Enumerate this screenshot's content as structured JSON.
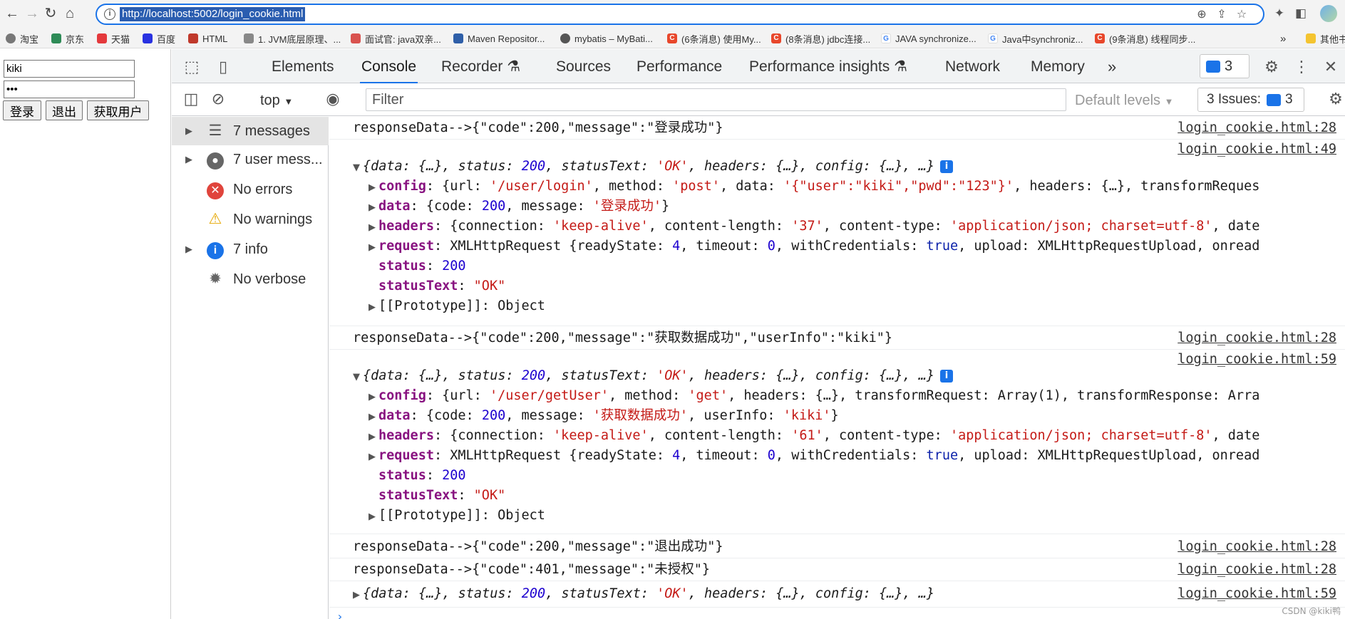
{
  "browser": {
    "url": "http://localhost:5002/login_cookie.html",
    "bookmarks": [
      "淘宝",
      "京东",
      "天猫",
      "百度",
      "HTML",
      "1. JVM底层原理、...",
      "面试官: java双亲...",
      "Maven Repositor...",
      "mybatis – MyBati...",
      "(6条消息) 使用My...",
      "(8条消息) jdbc连接...",
      "JAVA synchronize...",
      "Java中synchroniz...",
      "(9条消息) 线程同步..."
    ],
    "bookmarks_more": "»",
    "other_bookmarks": "其他书"
  },
  "page": {
    "username_value": "kiki",
    "password_value": "•••",
    "login_button": "登录",
    "logout_button": "退出",
    "getuser_button": "获取用户"
  },
  "devtools": {
    "tabs": [
      "Elements",
      "Console",
      "Recorder",
      "Sources",
      "Performance",
      "Performance insights",
      "Network",
      "Memory"
    ],
    "active_tab": "Console",
    "more_tabs": "»",
    "issues_count": "3",
    "context": "top",
    "filter_placeholder": "Filter",
    "levels": "Default levels",
    "issues_label": "3 Issues:",
    "issues_badge_count": "3"
  },
  "sidebar": {
    "items": [
      {
        "label": "7 messages",
        "icon": "list-icon"
      },
      {
        "label": "7 user mess...",
        "icon": "user-icon"
      },
      {
        "label": "No errors",
        "icon": "error-icon"
      },
      {
        "label": "No warnings",
        "icon": "warning-icon"
      },
      {
        "label": "7 info",
        "icon": "info-icon"
      },
      {
        "label": "No verbose",
        "icon": "bug-icon"
      }
    ]
  },
  "console": {
    "src_28": "login_cookie.html:28",
    "src_49": "login_cookie.html:49",
    "src_59": "login_cookie.html:59",
    "log_login": "responseData-->{\"code\":200,\"message\":\"登录成功\"}",
    "log_getuser": "responseData-->{\"code\":200,\"message\":\"获取数据成功\",\"userInfo\":\"kiki\"}",
    "log_logout": "responseData-->{\"code\":200,\"message\":\"退出成功\"}",
    "log_unauth": "responseData-->{\"code\":401,\"message\":\"未授权\"}"
  },
  "watermark": "CSDN @kiki鸭",
  "colors": {
    "accent": "#1a73e8",
    "keyword": "#881280",
    "string": "#c41a16",
    "number": "#1c00cf"
  }
}
